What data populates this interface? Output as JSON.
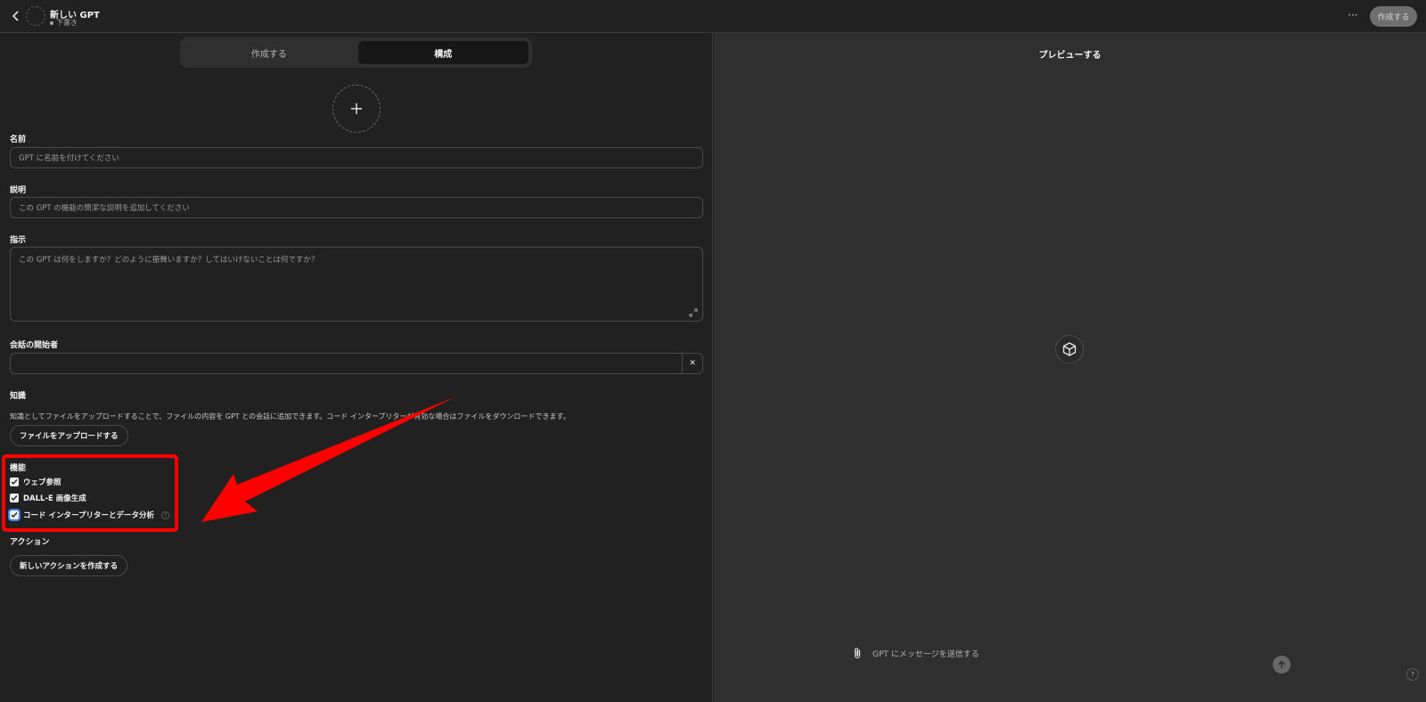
{
  "header": {
    "title": "新しい GPT",
    "status": "下書き",
    "more_label": "···",
    "create_button": "作成する"
  },
  "tabs": [
    {
      "label": "作成する",
      "active": false
    },
    {
      "label": "構成",
      "active": true
    }
  ],
  "form": {
    "name_label": "名前",
    "name_placeholder": "GPT に名前を付けてください",
    "description_label": "説明",
    "description_placeholder": "この GPT の機能の簡潔な説明を追加してください",
    "instructions_label": "指示",
    "instructions_placeholder": "この GPT は何をしますか？どのように振舞いますか？してはいけないことは何ですか？",
    "starters_label": "会話の開始者",
    "starters_value": "",
    "clear_label": "✕",
    "knowledge_label": "知識",
    "knowledge_description": "知識としてファイルをアップロードすることで、ファイルの内容を GPT との会話に追加できます。コード インタープリターが有効な場合はファイルをダウンロードできます。",
    "upload_button": "ファイルをアップロードする",
    "capabilities_label": "機能",
    "capabilities": [
      {
        "label": "ウェブ参照",
        "checked": true
      },
      {
        "label": "DALL-E 画像生成",
        "checked": true
      },
      {
        "label": "コード インタープリターとデータ分析",
        "checked": true
      }
    ],
    "help_glyph": "?",
    "actions_label": "アクション",
    "new_action_button": "新しいアクションを作成する"
  },
  "preview": {
    "title": "プレビューする",
    "message_placeholder": "GPT にメッセージを送信する",
    "help_label": "?"
  },
  "annotation": {
    "highlight_color": "#ff0000",
    "arrow_color": "#ff0000"
  },
  "icons": [
    "back-icon",
    "plus-icon",
    "expand-icon",
    "cube-icon",
    "paperclip-icon",
    "arrow-up-icon",
    "check-icon"
  ]
}
